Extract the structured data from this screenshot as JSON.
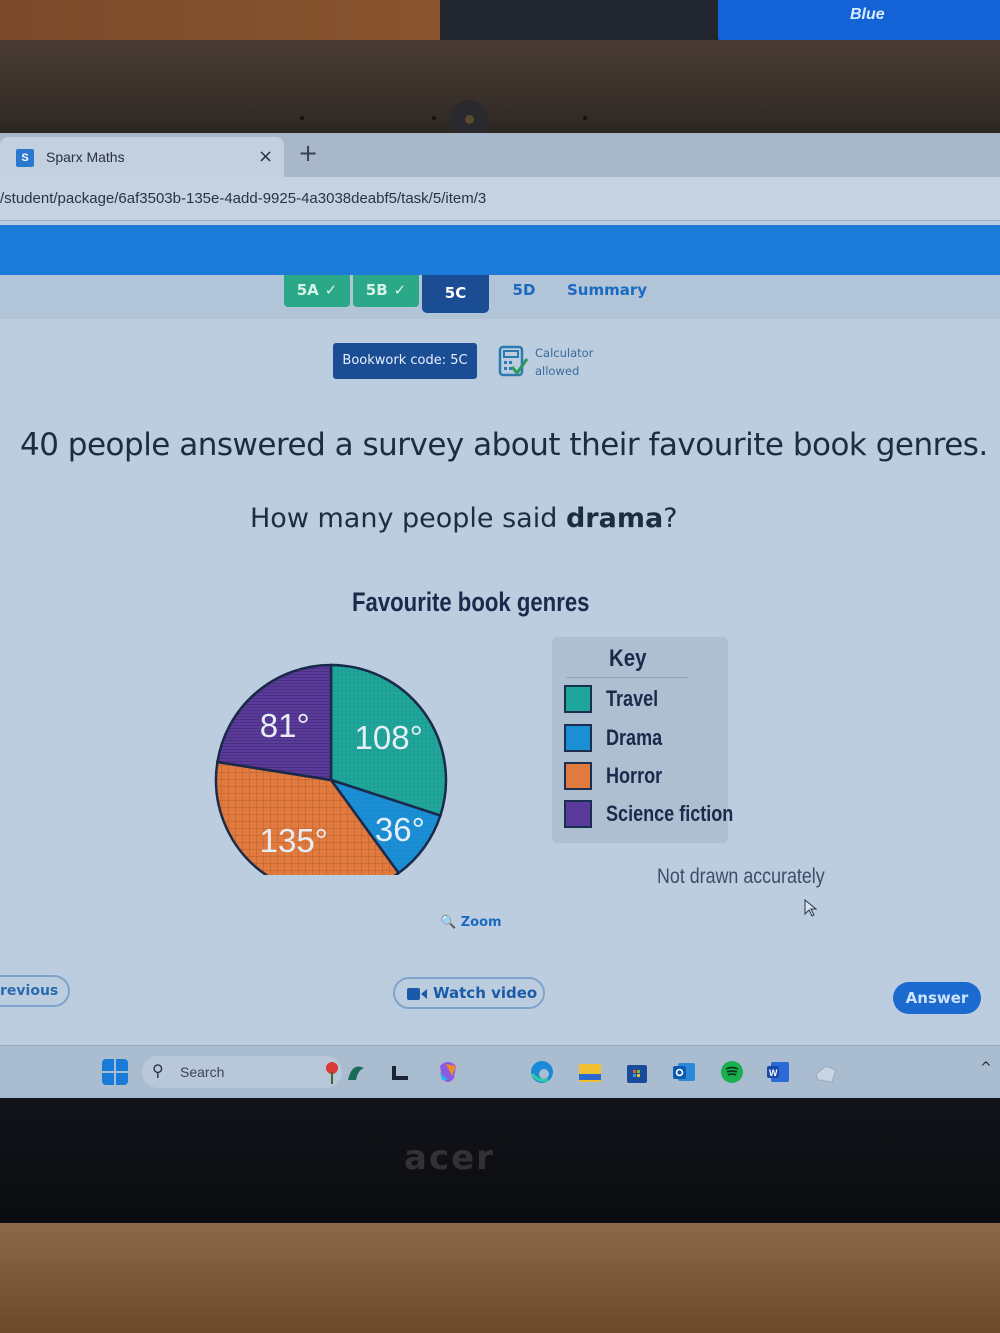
{
  "background": {
    "other_screen_text": "Blue",
    "bezel_logo": "acer",
    "desk_reflection": "acer"
  },
  "browser": {
    "tab_title": "Sparx Maths",
    "tab_favicon_letter": "S",
    "close_tab_glyph": "×",
    "new_tab_glyph": "+",
    "url": "/student/package/6af3503b-135e-4add-9925-4a3038deabf5/task/5/item/3"
  },
  "app": {
    "brand_color": "#1c7bd8",
    "subtabs": [
      {
        "label": "5A",
        "state": "done",
        "check": "✓"
      },
      {
        "label": "5B",
        "state": "done",
        "check": "✓"
      },
      {
        "label": "5C",
        "state": "active"
      },
      {
        "label": "5D",
        "state": "plain"
      },
      {
        "label": "Summary",
        "state": "plain"
      }
    ],
    "bookwork_code": "Bookwork code: 5C",
    "calculator_line1": "Calculator",
    "calculator_line2": "allowed",
    "question": "40 people answered a survey about their favourite book genres.",
    "subquestion_prefix": "How many people said ",
    "subquestion_bold": "drama",
    "subquestion_suffix": "?",
    "not_drawn": "Not drawn accurately",
    "zoom_label": "Zoom",
    "previous_label": "revious",
    "watch_video_label": "Watch video",
    "answer_label": "Answer"
  },
  "chart_data": {
    "type": "pie",
    "title": "Favourite book genres",
    "legend_title": "Key",
    "legend_position": "right",
    "unit": "degrees",
    "start": "top",
    "direction": "clockwise",
    "slices": [
      {
        "name": "Travel",
        "value": 108,
        "label": "108°",
        "color": "#1fa59a"
      },
      {
        "name": "Drama",
        "value": 36,
        "label": "36°",
        "color": "#1b8fd6"
      },
      {
        "name": "Horror",
        "value": 135,
        "label": "135°",
        "color": "#e07a3e"
      },
      {
        "name": "Science fiction",
        "value": 81,
        "label": "81°",
        "color": "#5a3a9a"
      }
    ],
    "total_people": 40
  },
  "taskbar": {
    "search_label": "Search",
    "icons": [
      "windows-start-icon",
      "widgets-icon",
      "task-view-icon",
      "copilot-icon",
      "edge-icon",
      "file-explorer-icon",
      "microsoft-store-icon",
      "outlook-icon",
      "spotify-icon",
      "word-icon",
      "app-icon"
    ],
    "chevron": "^"
  }
}
